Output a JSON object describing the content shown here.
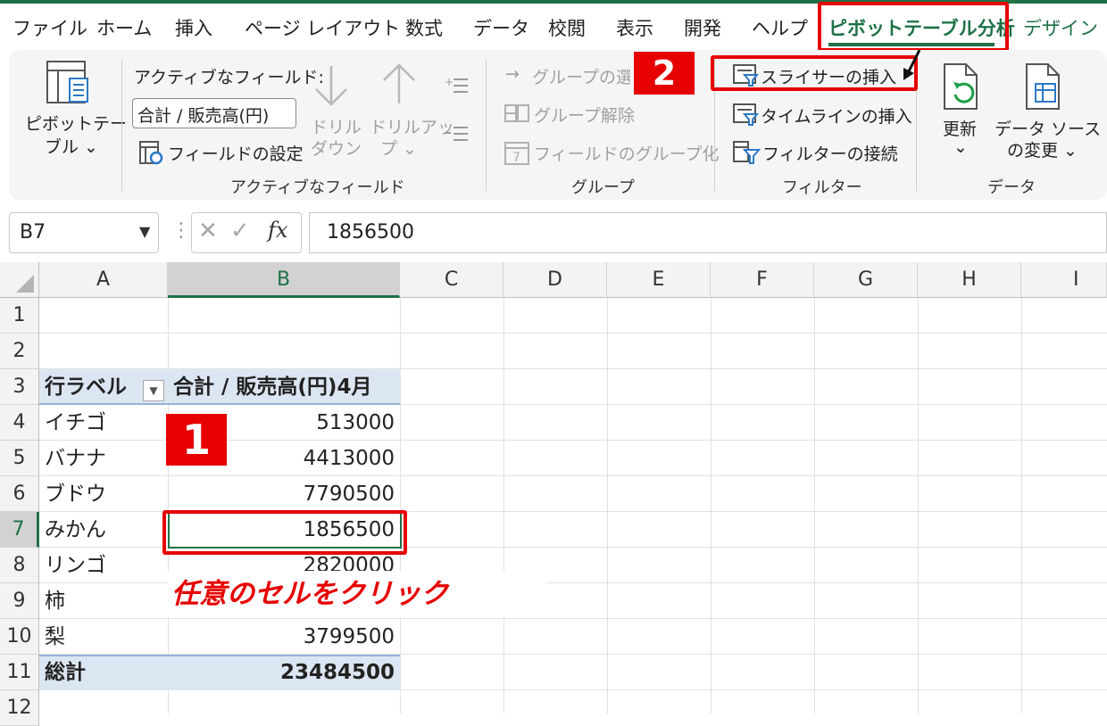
{
  "tabs": [
    "ファイル",
    "ホーム",
    "挿入",
    "ページ レイアウト",
    "数式",
    "データ",
    "校閲",
    "表示",
    "開発",
    "ヘルプ",
    "ピボットテーブル分析",
    "デザイン"
  ],
  "active_tab": "ピボットテーブル分析",
  "ribbon": {
    "pivot_table": {
      "line1": "ピボットテー",
      "line2": "ブル ⌄"
    },
    "active_field": {
      "label": "アクティブなフィールド:",
      "value": "合計 / 販売高(円)",
      "settings": "フィールドの設定",
      "drill_down": [
        "ドリル",
        "ダウン"
      ],
      "drill_up": [
        "ドリルアッ",
        "プ ⌄"
      ],
      "group_label": "アクティブなフィールド"
    },
    "group": {
      "selection": "グループの選択",
      "ungroup": "グループ解除",
      "group_field": "フィールドのグループ化",
      "group_label": "グループ"
    },
    "filter": {
      "insert_slicer": "スライサーの挿入",
      "insert_timeline": "タイムラインの挿入",
      "filter_connections": "フィルターの接続",
      "group_label": "フィルター"
    },
    "data": {
      "refresh": "更新",
      "refresh_arrow": "⌄",
      "change_source": [
        "データ ソース",
        "の変更 ⌄"
      ],
      "group_label": "データ"
    }
  },
  "formula_bar": {
    "name_box": "B7",
    "fx": "fx",
    "value": "1856500"
  },
  "columns": [
    "A",
    "B",
    "C",
    "D",
    "E",
    "F",
    "G",
    "H",
    "I"
  ],
  "rows": [
    "1",
    "2",
    "3",
    "4",
    "5",
    "6",
    "7",
    "8",
    "9",
    "10",
    "11",
    "12"
  ],
  "pivot": {
    "header_label": "行ラベル",
    "header_value": "合計 / 販売高(円)4月",
    "rows": [
      {
        "label": "イチゴ",
        "value": "513000"
      },
      {
        "label": "バナナ",
        "value": "4413000"
      },
      {
        "label": "ブドウ",
        "value": "7790500"
      },
      {
        "label": "みかん",
        "value": "1856500"
      },
      {
        "label": "リンゴ",
        "value": "2820000"
      },
      {
        "label": "柿",
        "value": ""
      },
      {
        "label": "梨",
        "value": "3799500"
      }
    ],
    "total_label": "総計",
    "total_value": "23484500"
  },
  "annotations": {
    "badge1": "1",
    "badge2": "2",
    "instruction": "任意のセルをクリック"
  },
  "colors": {
    "excel_green": "#1e7145",
    "annotation_red": "#e60000",
    "pivot_header": "#dce6f2"
  }
}
